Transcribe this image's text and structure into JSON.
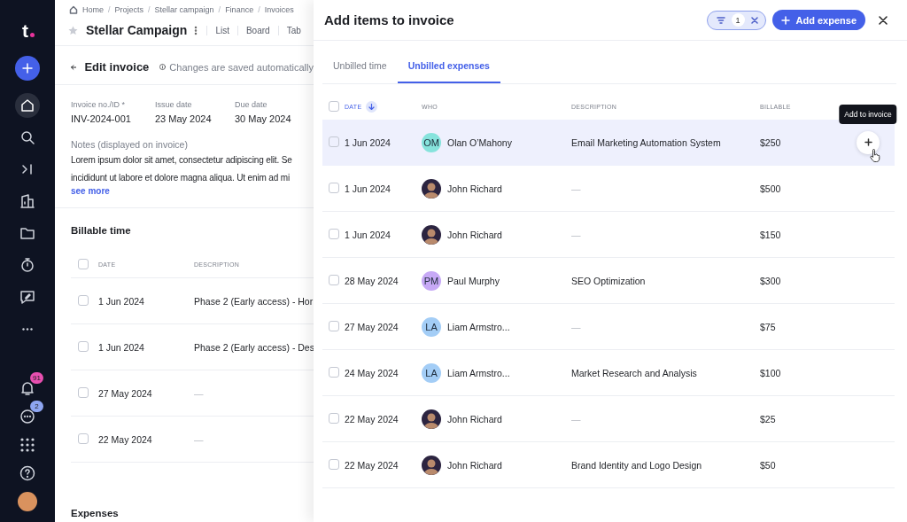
{
  "sidebar": {
    "logo": "t",
    "nav": [
      {
        "selected": false
      },
      {
        "selected": true
      },
      {
        "selected": false
      },
      {
        "selected": false
      },
      {
        "selected": false
      },
      {
        "selected": false
      },
      {
        "selected": false
      },
      {
        "selected": false
      },
      {
        "selected": false
      }
    ],
    "badges": [
      {
        "count": "91",
        "color": "#e84fb0"
      },
      {
        "count": "2",
        "color": "#8ea6f2"
      }
    ]
  },
  "breadcrumbs": [
    "Home",
    "Projects",
    "Stellar campaign",
    "Finance",
    "Invoices"
  ],
  "breadcrumb_separator": "/",
  "project": {
    "title": "Stellar Campaign",
    "views": [
      "List",
      "Board",
      "Tab"
    ]
  },
  "invoice": {
    "title": "Edit invoice",
    "info": "Changes are saved automatically",
    "fields": [
      {
        "label": "Invoice no./ID *",
        "value": "INV-2024-001"
      },
      {
        "label": "Issue date",
        "value": "23 May 2024"
      },
      {
        "label": "Due date",
        "value": "30 May 2024"
      }
    ],
    "notes_label": "Notes (displayed on invoice)",
    "notes_lines": [
      "Lorem ipsum dolor sit amet, consectetur adipiscing elit. Se",
      "incididunt ut labore et dolore magna aliqua. Ut enim ad mi"
    ],
    "see_more": "see more",
    "billable_time": {
      "title": "Billable time",
      "select_all_checked": false,
      "columns": [
        "DATE",
        "DESCRIPTION"
      ],
      "rows": [
        {
          "checked": false,
          "date": "1 Jun 2024",
          "description": "Phase 2 (Early access) - Hor"
        },
        {
          "checked": false,
          "date": "1 Jun 2024",
          "description": "Phase 2 (Early access) - Des"
        },
        {
          "checked": false,
          "date": "27 May 2024",
          "description": "—"
        },
        {
          "checked": false,
          "date": "22 May 2024",
          "description": "—"
        }
      ]
    },
    "expenses_title": "Expenses"
  },
  "drawer": {
    "title": "Add items to invoice",
    "filter_count": "1",
    "add_button": "Add expense",
    "select_all_checked": false,
    "tabs": [
      {
        "label": "Unbilled time",
        "selected": false
      },
      {
        "label": "Unbilled expenses",
        "selected": true
      }
    ],
    "columns": [
      {
        "label": "DATE",
        "sorted": true
      },
      {
        "label": "WHO",
        "sorted": false
      },
      {
        "label": "DESCRIPTION",
        "sorted": false
      },
      {
        "label": "BILLABLE",
        "sorted": false
      }
    ],
    "tooltip": "Add to invoice",
    "rows": [
      {
        "checked": false,
        "hovered": true,
        "date": "1 Jun 2024",
        "who": {
          "name": "Olan O’Mahony",
          "kind": "initials",
          "initials": "OM",
          "color": "#86e3dc"
        },
        "description": "Email Marketing Automation System",
        "billable": "$250"
      },
      {
        "checked": false,
        "hovered": false,
        "date": "1 Jun 2024",
        "who": {
          "name": "John Richard",
          "kind": "photo"
        },
        "description": "—",
        "billable": "$500"
      },
      {
        "checked": false,
        "hovered": false,
        "date": "1 Jun 2024",
        "who": {
          "name": "John Richard",
          "kind": "photo"
        },
        "description": "—",
        "billable": "$150"
      },
      {
        "checked": false,
        "hovered": false,
        "date": "28 May 2024",
        "who": {
          "name": "Paul Murphy",
          "kind": "initials",
          "initials": "PM",
          "color": "#c7a9f6"
        },
        "description": "SEO Optimization",
        "billable": "$300"
      },
      {
        "checked": false,
        "hovered": false,
        "date": "27 May 2024",
        "who": {
          "name": "Liam Armstro...",
          "kind": "initials",
          "initials": "LA",
          "color": "#a3cdf6"
        },
        "description": "—",
        "billable": "$75"
      },
      {
        "checked": false,
        "hovered": false,
        "date": "24 May 2024",
        "who": {
          "name": "Liam Armstro...",
          "kind": "initials",
          "initials": "LA",
          "color": "#a3cdf6"
        },
        "description": "Market Research and Analysis",
        "billable": "$100"
      },
      {
        "checked": false,
        "hovered": false,
        "date": "22 May 2024",
        "who": {
          "name": "John Richard",
          "kind": "photo"
        },
        "description": "—",
        "billable": "$25"
      },
      {
        "checked": false,
        "hovered": false,
        "date": "22 May 2024",
        "who": {
          "name": "John Richard",
          "kind": "photo"
        },
        "description": "Brand Identity and Logo Design",
        "billable": "$50"
      }
    ]
  }
}
